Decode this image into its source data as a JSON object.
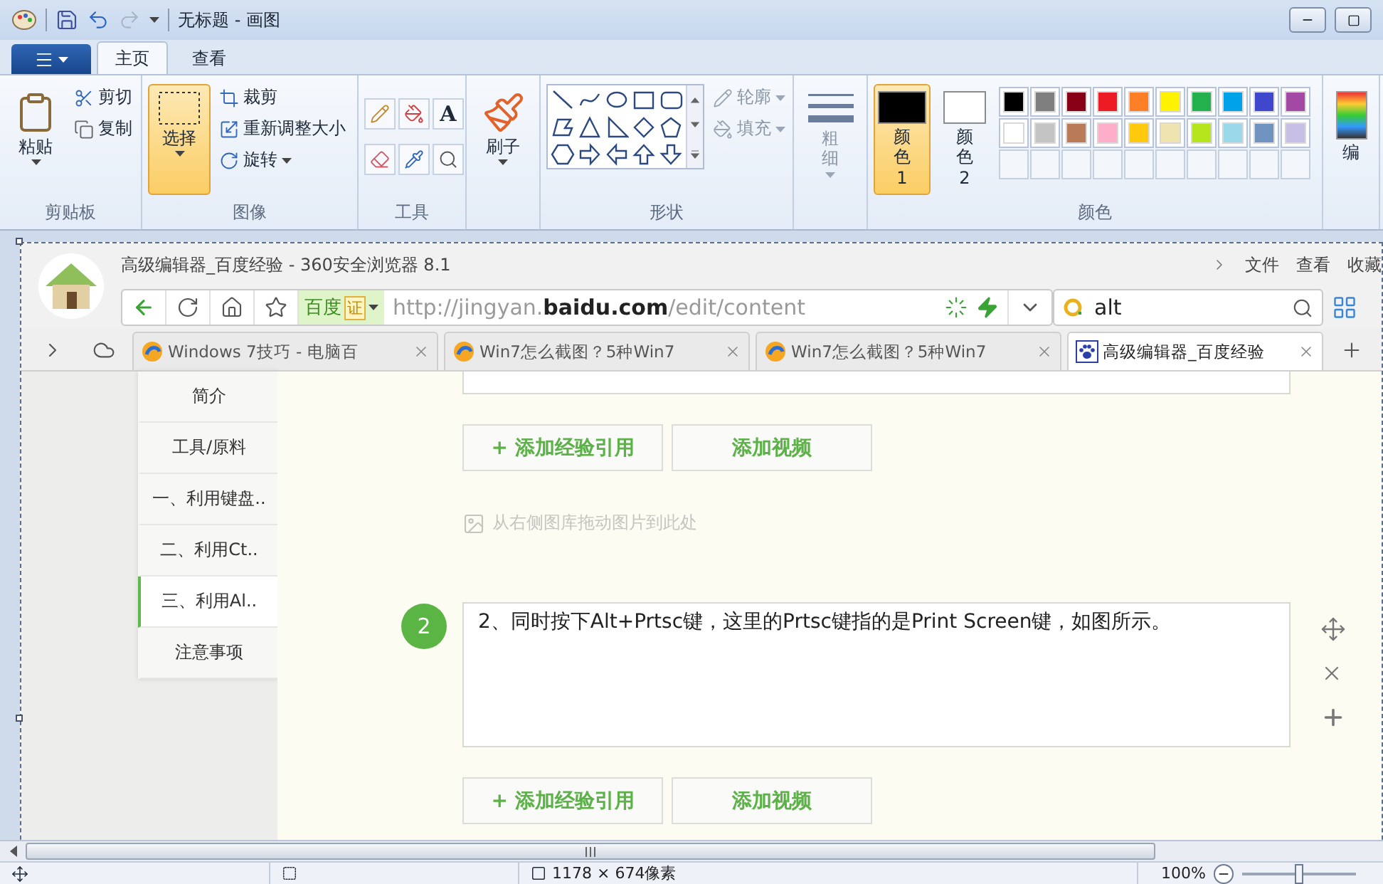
{
  "window": {
    "title": "无标题 - 画图"
  },
  "ribbon_tabs": [
    {
      "label": "主页",
      "selected": true
    },
    {
      "label": "查看",
      "selected": false
    }
  ],
  "clipboard": {
    "label": "剪贴板",
    "paste": "粘贴",
    "cut": "剪切",
    "copy": "复制"
  },
  "image": {
    "label": "图像",
    "select": {
      "label": "选择",
      "selected": true
    },
    "crop": "裁剪",
    "resize": "重新调整大小",
    "rotate": "旋转"
  },
  "tools": {
    "label": "工具",
    "text_tool": "A"
  },
  "brushes": {
    "label": "刷子"
  },
  "shapes": {
    "label": "形状",
    "outline": {
      "label": "轮廓",
      "disabled": true
    },
    "fill": {
      "label": "填充",
      "disabled": true
    }
  },
  "size": {
    "label": "粗细",
    "disabled": true
  },
  "colors": {
    "label": "颜色",
    "edit": "编",
    "active": [
      {
        "label": "颜色 1",
        "color": "#000000",
        "selected": true
      },
      {
        "label": "颜色 2",
        "color": "#ffffff",
        "selected": false
      }
    ],
    "palette": [
      {
        "color": "#000000"
      },
      {
        "color": "#7f7f7f"
      },
      {
        "color": "#880015"
      },
      {
        "color": "#ed1c24"
      },
      {
        "color": "#ff7f27"
      },
      {
        "color": "#fff200"
      },
      {
        "color": "#22b14c"
      },
      {
        "color": "#00a2e8"
      },
      {
        "color": "#3f48cc"
      },
      {
        "color": "#a349a4"
      },
      {
        "color": "#ffffff"
      },
      {
        "color": "#c3c3c3"
      },
      {
        "color": "#b97a57"
      },
      {
        "color": "#ffaec9"
      },
      {
        "color": "#ffc90e"
      },
      {
        "color": "#efe4b0"
      },
      {
        "color": "#b5e61d"
      },
      {
        "color": "#99d9ea"
      },
      {
        "color": "#7092be"
      },
      {
        "color": "#c8bfe7"
      }
    ]
  },
  "browser": {
    "title": "高级编辑器_百度经验 - 360安全浏览器 8.1",
    "menu": [
      "文件",
      "查看",
      "收藏"
    ],
    "search_engine": "百度",
    "certificate": "证",
    "url": "http://jingyan.**baidu.com**/edit/content",
    "search": "alt",
    "tabs": [
      {
        "title": "Windows 7技巧 - 电脑百",
        "kind": "swirl",
        "selected": false
      },
      {
        "title": "Win7怎么截图？5种Win7",
        "kind": "swirl",
        "selected": false
      },
      {
        "title": "Win7怎么截图？5种Win7",
        "kind": "swirl",
        "selected": false
      },
      {
        "title": "高级编辑器_百度经验",
        "kind": "paw",
        "selected": true
      }
    ],
    "nav": [
      {
        "label": "简介",
        "selected": false
      },
      {
        "label": "工具/原料",
        "selected": false
      },
      {
        "label": "一、利用键盘..",
        "selected": false
      },
      {
        "label": "二、利用Ct..",
        "selected": false
      },
      {
        "label": "三、利用Al..",
        "selected": true
      },
      {
        "label": "注意事项",
        "selected": false
      }
    ],
    "actions_top": [
      "+ 添加经验引用",
      "添加视频"
    ],
    "image_hint": "从右侧图库拖动图片到此处",
    "step": {
      "number": "2",
      "text": "2、同时按下Alt+Prtsc键，这里的Prtsc键指的是Print Screen键，如图所示。"
    },
    "actions_bottom": [
      "+ 添加经验引用",
      "添加视频"
    ]
  },
  "status_bar": {
    "dimensions": "1178 × 674像素",
    "zoom": "100%",
    "zoom_slider": {
      "level": 0.5
    }
  }
}
